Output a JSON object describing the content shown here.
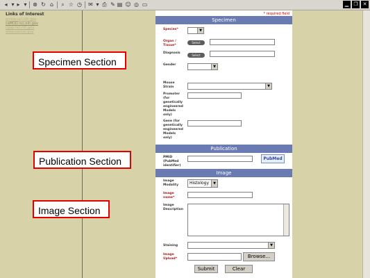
{
  "toolbar": {
    "icons": [
      "back-icon",
      "forward-icon",
      "stop-icon",
      "refresh-icon",
      "home-icon",
      "search-icon",
      "favorites-icon",
      "history-icon",
      "mail-icon",
      "print-icon",
      "edit-icon",
      "discuss-icon",
      "messenger-icon",
      "research-icon",
      "folder-icon"
    ]
  },
  "links": {
    "title": "Links of Interest",
    "items": [
      "emice.nci.nih.gov",
      "caMOD.nci.nih.gov",
      "cgap.nci.nih.gov",
      "www.cancer.gov"
    ]
  },
  "callouts": {
    "specimen": "Specimen Section",
    "publication": "Publication Section",
    "image": "Image Section"
  },
  "form": {
    "required_note": "* required field",
    "specimen": {
      "header": "Specimen",
      "species": "Species*",
      "organ": "Organ / Tissue*",
      "diagnosis": "Diagnosis",
      "gender": "Gender",
      "mouse_strain": "Mouse Strain",
      "promoter": "Promoter (for genetically engineered Models only)",
      "gene": "Gene (for genetically engineered Models only)",
      "select_label": "Select"
    },
    "publication": {
      "header": "Publication",
      "pmid": "PMID (PubMed identifier)",
      "pubmed_label": "PubMed"
    },
    "image": {
      "header": "Image",
      "modality": "Image Modality",
      "modality_value": "Histology",
      "name": "Image name*",
      "description": "Image Description",
      "staining": "Staining",
      "upload": "Image Upload*",
      "browse": "Browse..."
    },
    "submit": "Submit",
    "clear": "Clear"
  }
}
